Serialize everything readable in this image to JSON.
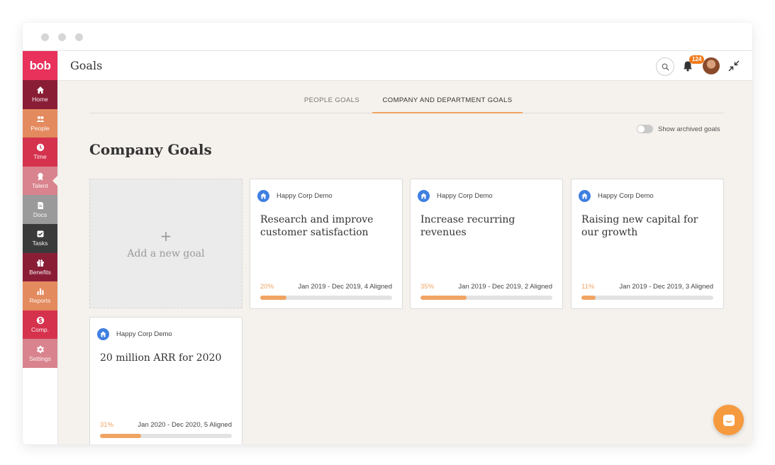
{
  "colors": {
    "brand": "#e8315b",
    "accent": "#f0a463",
    "background": "#f5f1ec",
    "org_icon": "#3f7fe0",
    "chat": "#f59a3e"
  },
  "logo": "bob",
  "sidebar": {
    "items": [
      {
        "label": "Home",
        "icon": "home-icon",
        "color": "#8a1d36"
      },
      {
        "label": "People",
        "icon": "people-icon",
        "color": "#e38a5e"
      },
      {
        "label": "Time",
        "icon": "clock-icon",
        "color": "#d5324e"
      },
      {
        "label": "Talent",
        "icon": "award-icon",
        "color": "#d9838e"
      },
      {
        "label": "Docs",
        "icon": "document-icon",
        "color": "#9a9a9a"
      },
      {
        "label": "Tasks",
        "icon": "checkbox-icon",
        "color": "#3a3a3a"
      },
      {
        "label": "Benefits",
        "icon": "gift-icon",
        "color": "#8a1d36"
      },
      {
        "label": "Reports",
        "icon": "bar-chart-icon",
        "color": "#e38a5e"
      },
      {
        "label": "Comp.",
        "icon": "dollar-icon",
        "color": "#d5324e"
      },
      {
        "label": "Settings",
        "icon": "gear-icon",
        "color": "#d9838e"
      }
    ],
    "active": "Talent"
  },
  "header": {
    "title": "Goals",
    "notification_count": "124"
  },
  "tabs": [
    {
      "label": "PEOPLE GOALS",
      "active": false
    },
    {
      "label": "COMPANY AND DEPARTMENT GOALS",
      "active": true
    }
  ],
  "toggle": {
    "label": "Show archived goals",
    "on": false
  },
  "section_title": "Company Goals",
  "add_card": {
    "plus": "+",
    "label": "Add a new goal"
  },
  "goals": [
    {
      "org": "Happy Corp Demo",
      "title": "Research and improve customer satisfaction",
      "percent": "20%",
      "progress": 0.2,
      "range": "Jan 2019 - Dec 2019, 4 Aligned"
    },
    {
      "org": "Happy Corp Demo",
      "title": "Increase recurring revenues",
      "percent": "35%",
      "progress": 0.35,
      "range": "Jan 2019 - Dec 2019, 2 Aligned"
    },
    {
      "org": "Happy Corp Demo",
      "title": "Raising new capital for our growth",
      "percent": "11%",
      "progress": 0.11,
      "range": "Jan 2019 - Dec 2019, 3 Aligned"
    },
    {
      "org": "Happy Corp Demo",
      "title": "20 million ARR for 2020",
      "percent": "31%",
      "progress": 0.31,
      "range": "Jan 2020 - Dec 2020, 5 Aligned"
    }
  ]
}
